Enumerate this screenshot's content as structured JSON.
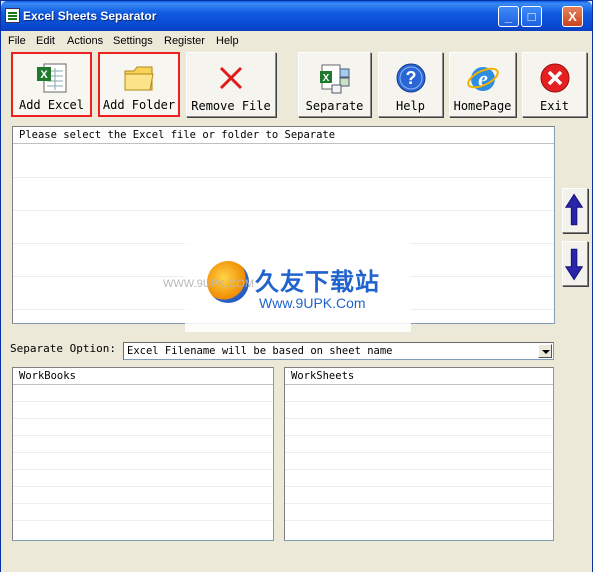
{
  "window": {
    "title": "Excel Sheets Separator"
  },
  "title_buttons": {
    "minimize": "_",
    "maximize": "□",
    "close": "X"
  },
  "menu": [
    "File",
    "Edit",
    "Actions",
    "Settings",
    "Register",
    "Help"
  ],
  "toolbar": [
    {
      "id": "add-excel",
      "label": "Add Excel",
      "icon": "excel-file-icon",
      "selected": true
    },
    {
      "id": "add-folder",
      "label": "Add Folder",
      "icon": "folder-icon",
      "selected": true
    },
    {
      "id": "remove-file",
      "label": "Remove File",
      "icon": "red-x-icon",
      "selected": false
    },
    {
      "id": "separate",
      "label": "Separate",
      "icon": "excel-separate-icon",
      "selected": false
    },
    {
      "id": "help",
      "label": "Help",
      "icon": "help-question-icon",
      "selected": false
    },
    {
      "id": "homepage",
      "label": "HomePage",
      "icon": "internet-explorer-icon",
      "selected": false
    },
    {
      "id": "exit",
      "label": "Exit",
      "icon": "exit-icon",
      "selected": false
    }
  ],
  "file_list": {
    "header": "Please select the Excel file or folder to Separate"
  },
  "move_buttons": {
    "up_icon": "arrow-up-icon",
    "down_icon": "arrow-down-icon"
  },
  "separate_option": {
    "label": "Separate Option:",
    "value": "Excel Filename will be based on sheet name"
  },
  "workbooks": {
    "header": "WorkBooks"
  },
  "worksheets": {
    "header": "WorkSheets"
  },
  "watermark": {
    "brand_cn": "久友下载站",
    "url": "Www.9UPK.Com",
    "small": "WWW.9UPK.COM"
  },
  "colors": {
    "titlebar": "#0846cf",
    "selected_border": "#ee1f1f",
    "arrow": "#2a25a8"
  }
}
